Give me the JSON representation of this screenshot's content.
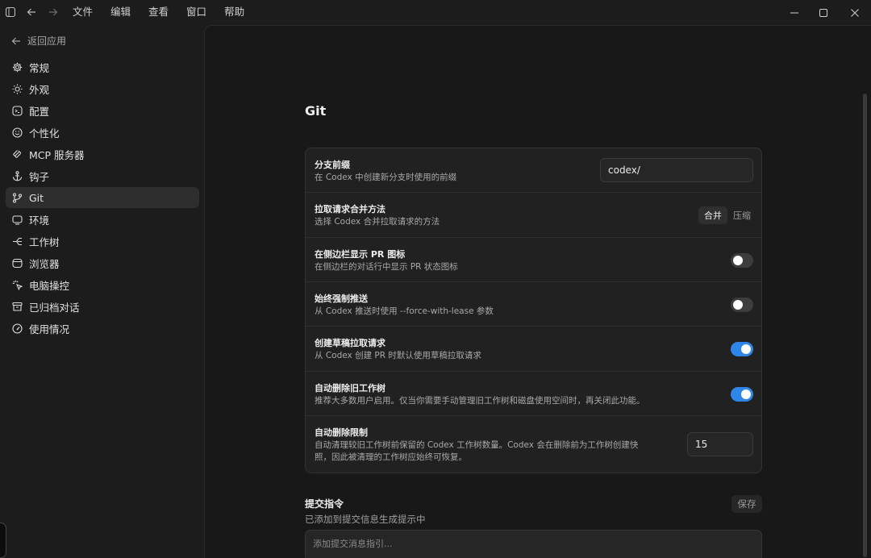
{
  "menu": [
    "文件",
    "编辑",
    "查看",
    "窗口",
    "帮助"
  ],
  "sidebar": {
    "back_label": "返回应用",
    "items": [
      {
        "label": "常规",
        "icon": "gear-icon"
      },
      {
        "label": "外观",
        "icon": "sun-icon"
      },
      {
        "label": "配置",
        "icon": "config-icon"
      },
      {
        "label": "个性化",
        "icon": "smile-icon"
      },
      {
        "label": "MCP 服务器",
        "icon": "mcp-icon"
      },
      {
        "label": "钩子",
        "icon": "anchor-icon"
      },
      {
        "label": "Git",
        "icon": "git-branch-icon",
        "active": true
      },
      {
        "label": "环境",
        "icon": "monitor-icon"
      },
      {
        "label": "工作树",
        "icon": "worktree-icon"
      },
      {
        "label": "浏览器",
        "icon": "browser-icon"
      },
      {
        "label": "电脑操控",
        "icon": "cursor-click-icon"
      },
      {
        "label": "已归档对话",
        "icon": "archive-icon"
      },
      {
        "label": "使用情况",
        "icon": "gauge-icon"
      }
    ]
  },
  "main": {
    "title": "Git",
    "settings": [
      {
        "title": "分支前缀",
        "desc": "在 Codex 中创建新分支时使用的前缀",
        "control": "text",
        "value": "codex/"
      },
      {
        "title": "拉取请求合并方法",
        "desc": "选择 Codex 合并拉取请求的方法",
        "control": "segmented",
        "options": [
          "合并",
          "压缩"
        ],
        "selected": "合并"
      },
      {
        "title": "在侧边栏显示 PR 图标",
        "desc": "在侧边栏的对话行中显示 PR 状态图标",
        "control": "toggle",
        "on": false
      },
      {
        "title": "始终强制推送",
        "desc": "从 Codex 推送时使用 --force-with-lease 参数",
        "control": "toggle",
        "on": false
      },
      {
        "title": "创建草稿拉取请求",
        "desc": "从 Codex 创建 PR 时默认使用草稿拉取请求",
        "control": "toggle",
        "on": true
      },
      {
        "title": "自动删除旧工作树",
        "desc": "推荐大多数用户启用。仅当你需要手动管理旧工作树和磁盘使用空间时，再关闭此功能。",
        "control": "toggle",
        "on": true
      },
      {
        "title": "自动删除限制",
        "desc_line1": "自动清理较旧工作树前保留的 Codex 工作树数量。Codex 会在删除前为工作树创建快",
        "desc_line2": "照，因此被清理的工作树应始终可恢复。",
        "control": "number",
        "value": "15"
      }
    ],
    "commit_section": {
      "title": "提交指令",
      "desc": "已添加到提交信息生成提示中",
      "save_label": "保存",
      "placeholder": "添加提交消息指引..."
    }
  },
  "colors": {
    "accent": "#2f86e8",
    "background": "#1c1c1c",
    "panel": "#181818"
  }
}
